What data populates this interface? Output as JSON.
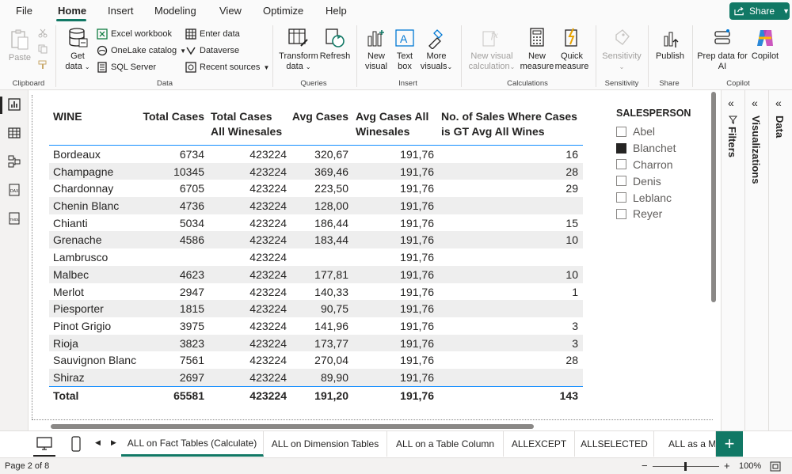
{
  "menu": {
    "items": [
      "File",
      "Home",
      "Insert",
      "Modeling",
      "View",
      "Optimize",
      "Help"
    ],
    "active": "Home",
    "share_label": "Share"
  },
  "ribbon": {
    "clipboard": {
      "paste": "Paste",
      "label": "Clipboard"
    },
    "data": {
      "get_data": "Get",
      "get_data2": "data",
      "excel": "Excel workbook",
      "onelake": "OneLake catalog",
      "sql": "SQL Server",
      "enter_data": "Enter data",
      "dataverse": "Dataverse",
      "recent": "Recent sources",
      "label": "Data"
    },
    "queries": {
      "transform": "Transform",
      "transform2": "data",
      "refresh": "Refresh",
      "label": "Queries"
    },
    "insert": {
      "new_visual": "New",
      "new_visual2": "visual",
      "text_box": "Text",
      "text_box2": "box",
      "more": "More",
      "more2": "visuals",
      "label": "Insert"
    },
    "calculations": {
      "new_visual_calc": "New visual",
      "new_visual_calc2": "calculation",
      "new_measure": "New",
      "new_measure2": "measure",
      "quick": "Quick",
      "quick2": "measure",
      "label": "Calculations"
    },
    "sensitivity": {
      "btn": "Sensitivity",
      "label": "Sensitivity"
    },
    "share": {
      "publish": "Publish",
      "label": "Share"
    },
    "copilot": {
      "prep": "Prep data for",
      "prep2": "AI",
      "copilot": "Copilot",
      "label": "Copilot"
    }
  },
  "table": {
    "headers": [
      [
        "WINE",
        ""
      ],
      [
        "Total Cases",
        ""
      ],
      [
        "Total Cases",
        "All Winesales"
      ],
      [
        "Avg Cases",
        ""
      ],
      [
        "Avg Cases All",
        "Winesales"
      ],
      [
        "No. of Sales Where Cases",
        "is GT Avg All Wines"
      ]
    ],
    "rows": [
      [
        "Bordeaux",
        "6734",
        "423224",
        "320,67",
        "191,76",
        "16"
      ],
      [
        "Champagne",
        "10345",
        "423224",
        "369,46",
        "191,76",
        "28"
      ],
      [
        "Chardonnay",
        "6705",
        "423224",
        "223,50",
        "191,76",
        "29"
      ],
      [
        "Chenin Blanc",
        "4736",
        "423224",
        "128,00",
        "191,76",
        ""
      ],
      [
        "Chianti",
        "5034",
        "423224",
        "186,44",
        "191,76",
        "15"
      ],
      [
        "Grenache",
        "4586",
        "423224",
        "183,44",
        "191,76",
        "10"
      ],
      [
        "Lambrusco",
        "",
        "423224",
        "",
        "191,76",
        ""
      ],
      [
        "Malbec",
        "4623",
        "423224",
        "177,81",
        "191,76",
        "10"
      ],
      [
        "Merlot",
        "2947",
        "423224",
        "140,33",
        "191,76",
        "1"
      ],
      [
        "Piesporter",
        "1815",
        "423224",
        "90,75",
        "191,76",
        ""
      ],
      [
        "Pinot Grigio",
        "3975",
        "423224",
        "141,96",
        "191,76",
        "3"
      ],
      [
        "Rioja",
        "3823",
        "423224",
        "173,77",
        "191,76",
        "3"
      ],
      [
        "Sauvignon Blanc",
        "7561",
        "423224",
        "270,04",
        "191,76",
        "28"
      ],
      [
        "Shiraz",
        "2697",
        "423224",
        "89,90",
        "191,76",
        ""
      ]
    ],
    "total": [
      "Total",
      "65581",
      "423224",
      "191,20",
      "191,76",
      "143"
    ]
  },
  "slicer": {
    "title": "SALESPERSON",
    "items": [
      {
        "label": "Abel",
        "checked": false
      },
      {
        "label": "Blanchet",
        "checked": true
      },
      {
        "label": "Charron",
        "checked": false
      },
      {
        "label": "Denis",
        "checked": false
      },
      {
        "label": "Leblanc",
        "checked": false
      },
      {
        "label": "Reyer",
        "checked": false
      }
    ]
  },
  "panes": {
    "filters": "Filters",
    "visualizations": "Visualizations",
    "data": "Data"
  },
  "pages": {
    "tabs": [
      "ALL on Fact Tables (Calculate)",
      "ALL on Dimension Tables",
      "ALL on a Table Column",
      "ALLEXCEPT",
      "ALLSELECTED",
      "ALL as a Mo"
    ],
    "active_index": 0
  },
  "status": {
    "page": "Page 2 of 8",
    "zoom": "100%"
  },
  "colors": {
    "accent": "#117865",
    "header_line": "#118dff"
  }
}
